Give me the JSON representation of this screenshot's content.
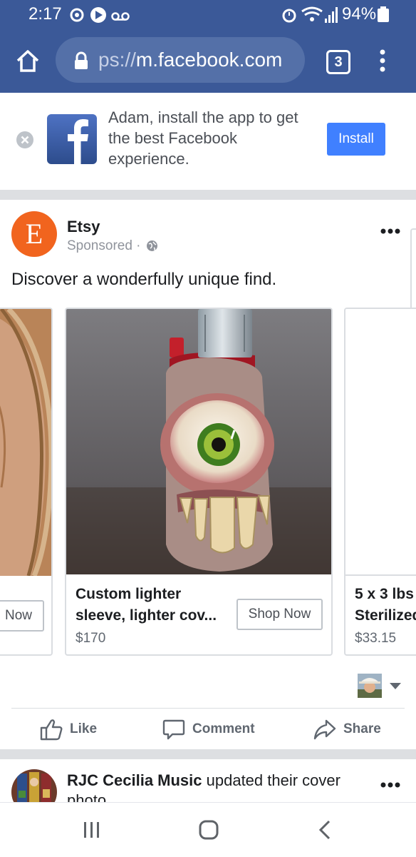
{
  "status_bar": {
    "time": "2:17",
    "battery": "94%"
  },
  "browser": {
    "url_prefix": "ps://",
    "url_host": "m.facebook.com",
    "tab_count": "3"
  },
  "install_banner": {
    "message": "Adam, install the app to get the best Facebook experience.",
    "button_label": "Install"
  },
  "post": {
    "avatar_letter": "E",
    "advertiser": "Etsy",
    "sponsored_label": "Sponsored ·",
    "text": "Discover a wonderfully unique find.",
    "cards": [
      {
        "button_label": "Now"
      },
      {
        "title_line1": "Custom lighter",
        "title_line2": "sleeve, lighter cov...",
        "price": "$170",
        "button_label": "Shop Now"
      },
      {
        "title_line1": "5 x 3 lbs",
        "title_line2": "Sterilized",
        "price": "$33.15"
      }
    ],
    "actions": {
      "like": "Like",
      "comment": "Comment",
      "share": "Share"
    }
  },
  "next_post": {
    "page_name": "RJC Cecilia Music",
    "action_text": " updated their cover photo."
  },
  "colors": {
    "facebook_blue": "#3b5998",
    "install_blue": "#4080ff",
    "etsy_orange": "#f1641e"
  }
}
